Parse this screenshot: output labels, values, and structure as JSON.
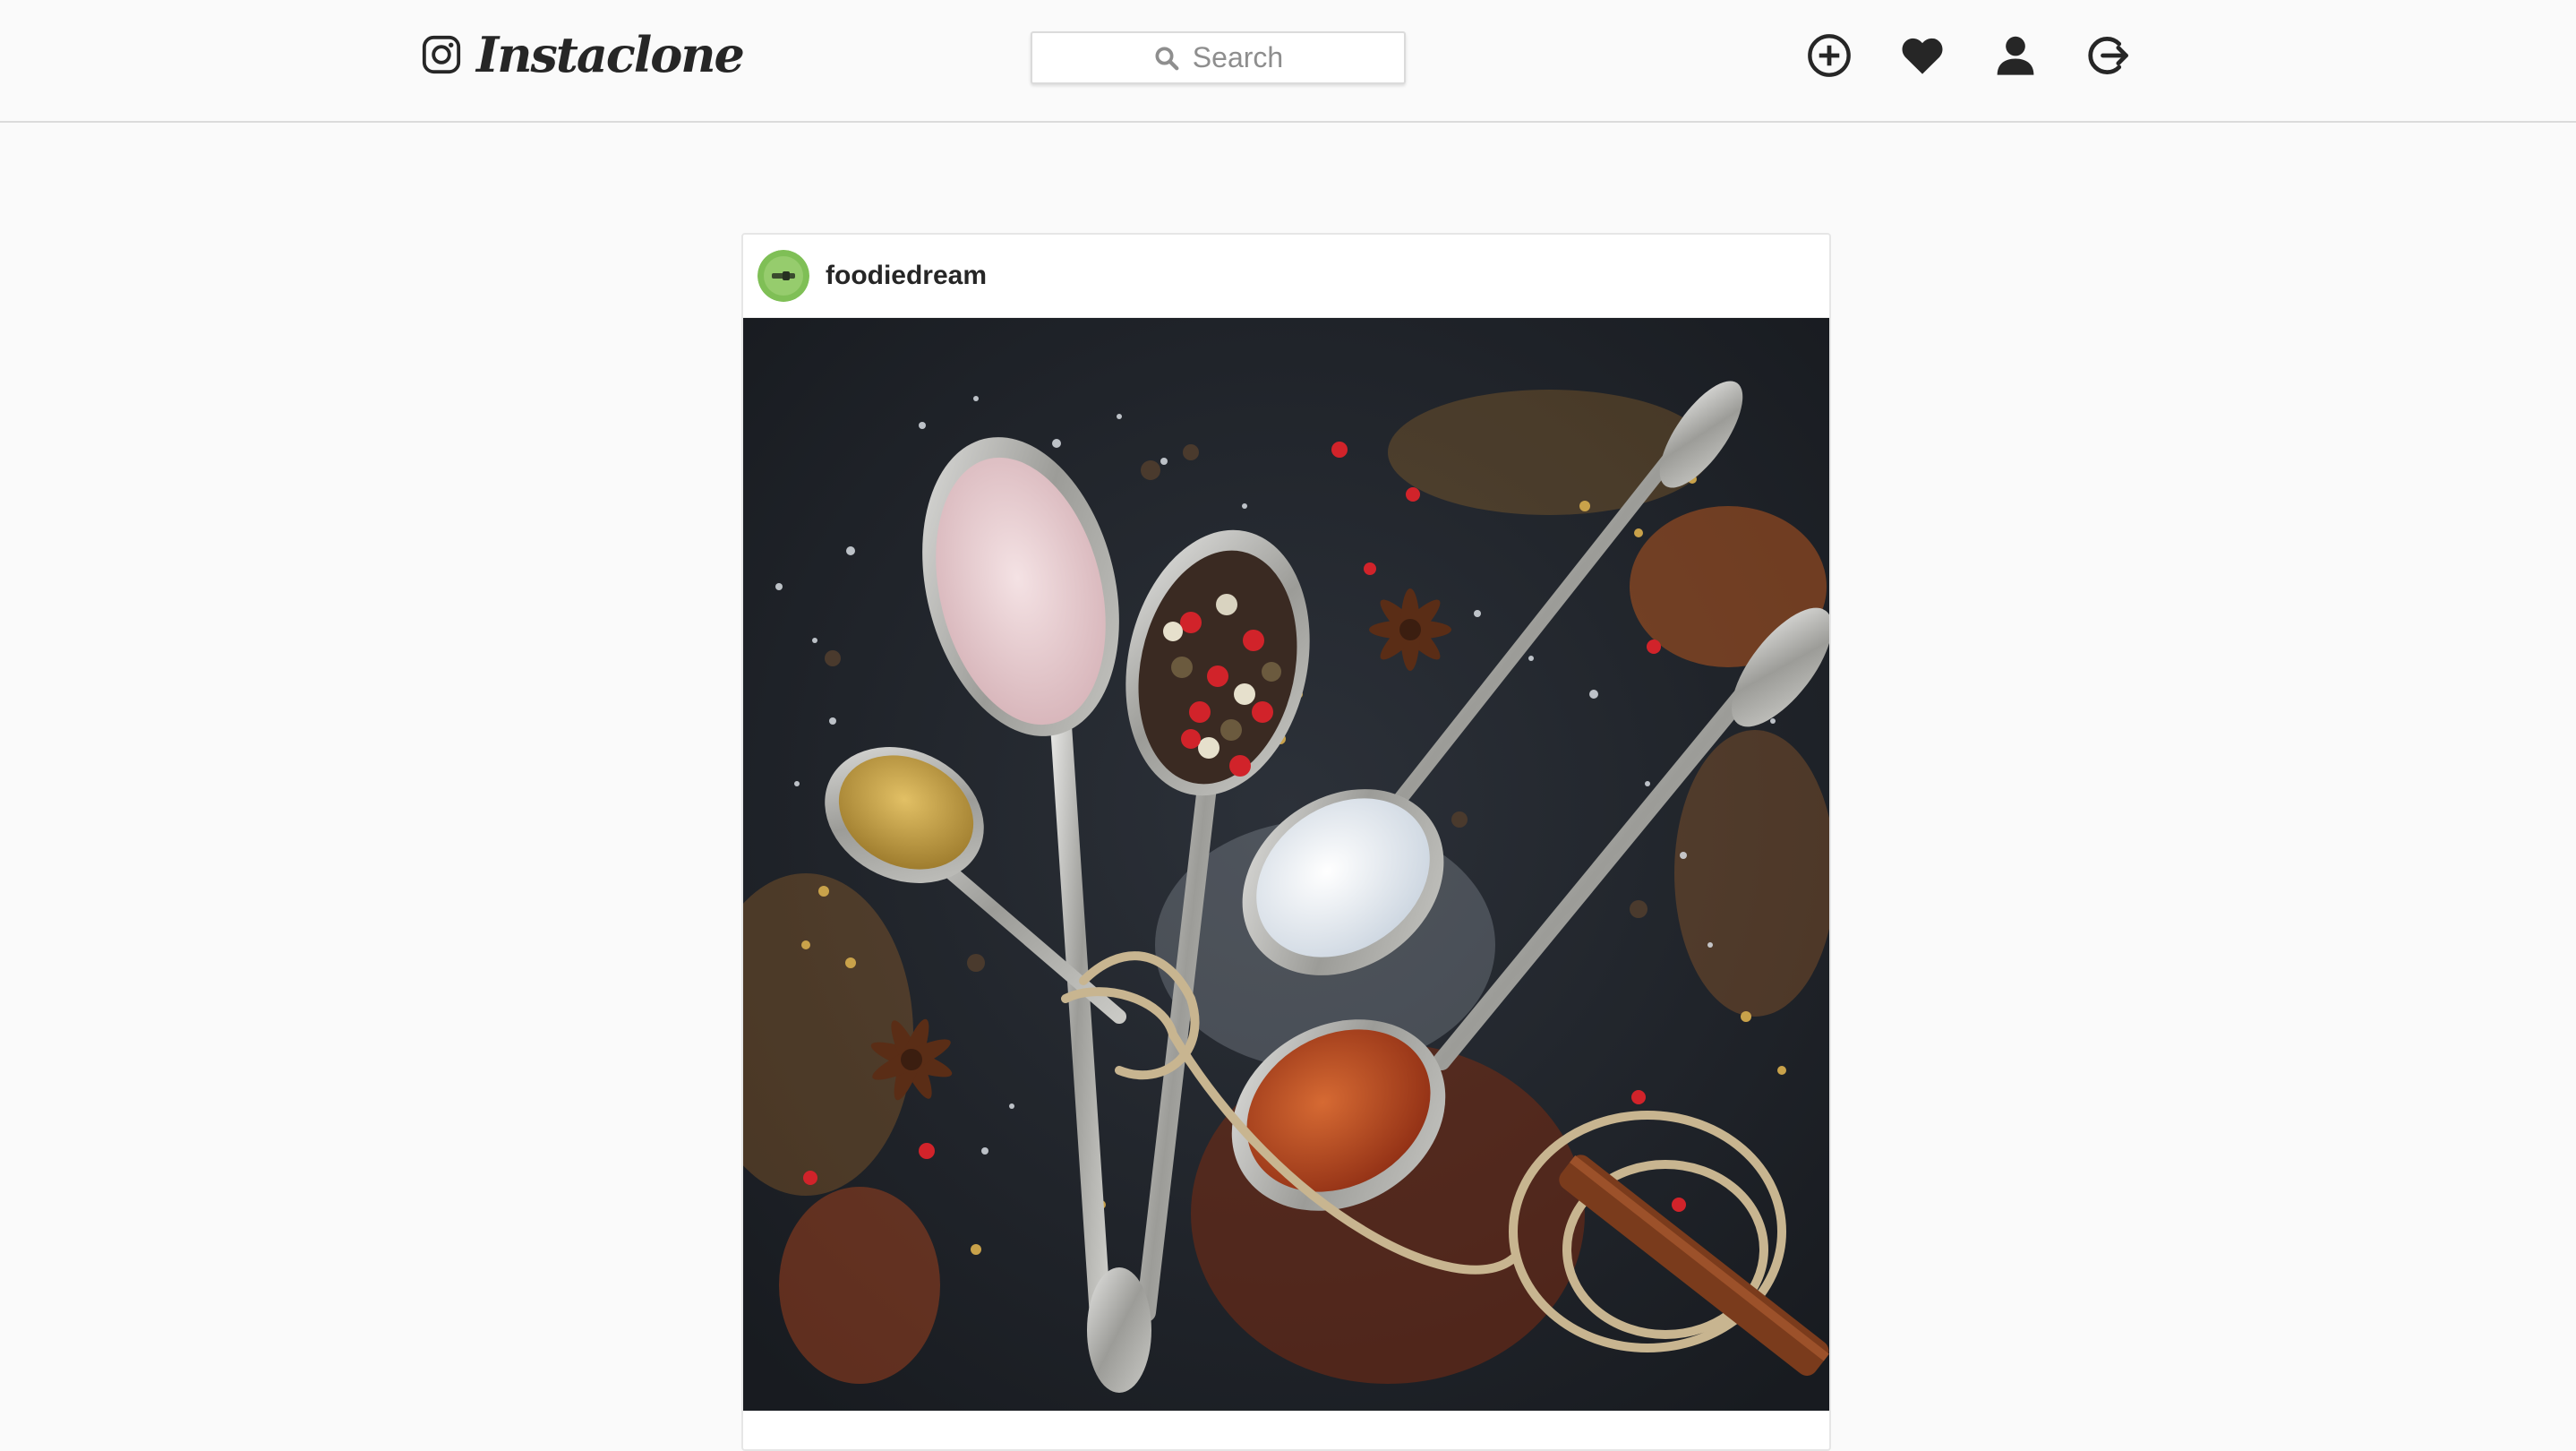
{
  "header": {
    "logo_icon": "instagram-camera-icon",
    "brand_name": "Instaclone",
    "search": {
      "placeholder": "Search",
      "icon": "search-icon"
    },
    "nav_icons": [
      "add-post-icon",
      "heart-icon",
      "profile-icon",
      "logout-icon"
    ]
  },
  "post": {
    "username": "foodiedream",
    "avatar_icon": "avatar-image",
    "photo": "spices-in-spoons-photo"
  },
  "colors": {
    "background": "#fafafa",
    "border": "#dbdbdb",
    "text": "#262626",
    "muted": "#8e8e8e"
  }
}
